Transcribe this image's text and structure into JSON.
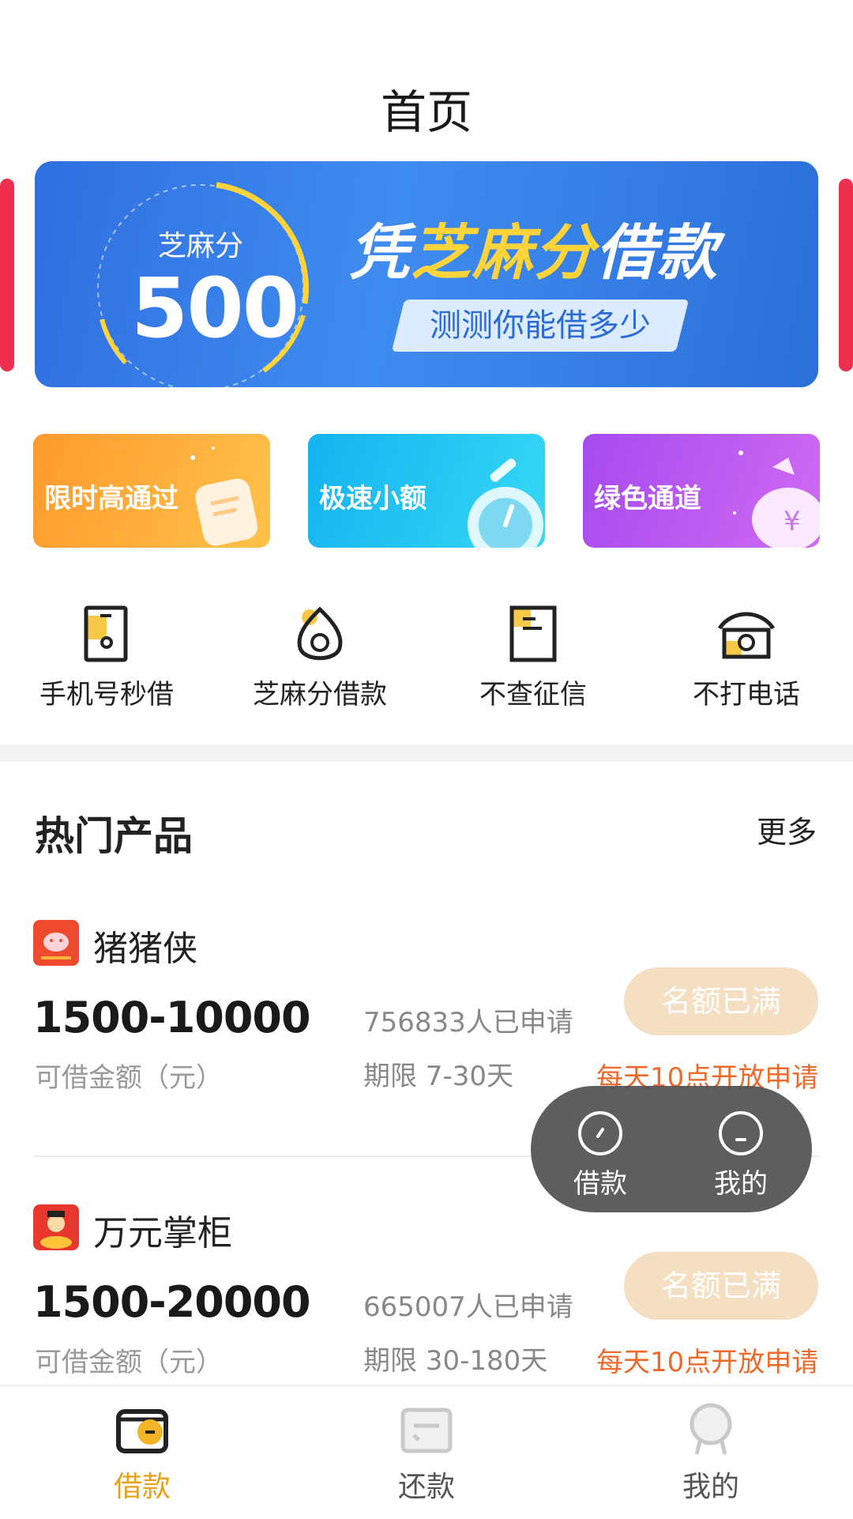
{
  "header": {
    "title": "首页"
  },
  "banner": {
    "score_label": "芝麻分",
    "score_value": "500",
    "title_prefix": "凭",
    "title_highlight": "芝麻分",
    "title_suffix": "借款",
    "cta": "测测你能借多少"
  },
  "promos": [
    {
      "label": "限时高通过",
      "icon": "hand-card-icon"
    },
    {
      "label": "极速小额",
      "icon": "stopwatch-icon"
    },
    {
      "label": "绿色通道",
      "icon": "money-bag-icon"
    }
  ],
  "shortcuts": [
    {
      "label": "手机号秒借",
      "icon": "phone-icon"
    },
    {
      "label": "芝麻分借款",
      "icon": "sesame-icon"
    },
    {
      "label": "不查征信",
      "icon": "document-icon"
    },
    {
      "label": "不打电话",
      "icon": "telephone-icon"
    }
  ],
  "section": {
    "title": "热门产品",
    "more": "更多"
  },
  "products": [
    {
      "name": "猪猪侠",
      "range": "1500-10000",
      "range_label": "可借金额（元）",
      "applied": "756833人已申请",
      "term": "期限 7-30天",
      "button": "名额已满",
      "notice": "每天10点开放申请"
    },
    {
      "name": "万元掌柜",
      "range": "1500-20000",
      "range_label": "可借金额（元）",
      "applied": "665007人已申请",
      "term": "期限 30-180天",
      "button": "名额已满",
      "notice": "每天10点开放申请"
    }
  ],
  "float_menu": {
    "items": [
      {
        "label": "借款"
      },
      {
        "label": "我的"
      }
    ]
  },
  "tabbar": {
    "items": [
      {
        "label": "借款",
        "active": true
      },
      {
        "label": "还款",
        "active": false
      },
      {
        "label": "我的",
        "active": false
      }
    ]
  },
  "colors": {
    "accent": "#e8a21a",
    "banner_blue": "#3f8cf0",
    "notice_orange": "#ee6a2a",
    "button_disabled": "#f5dfc3"
  }
}
